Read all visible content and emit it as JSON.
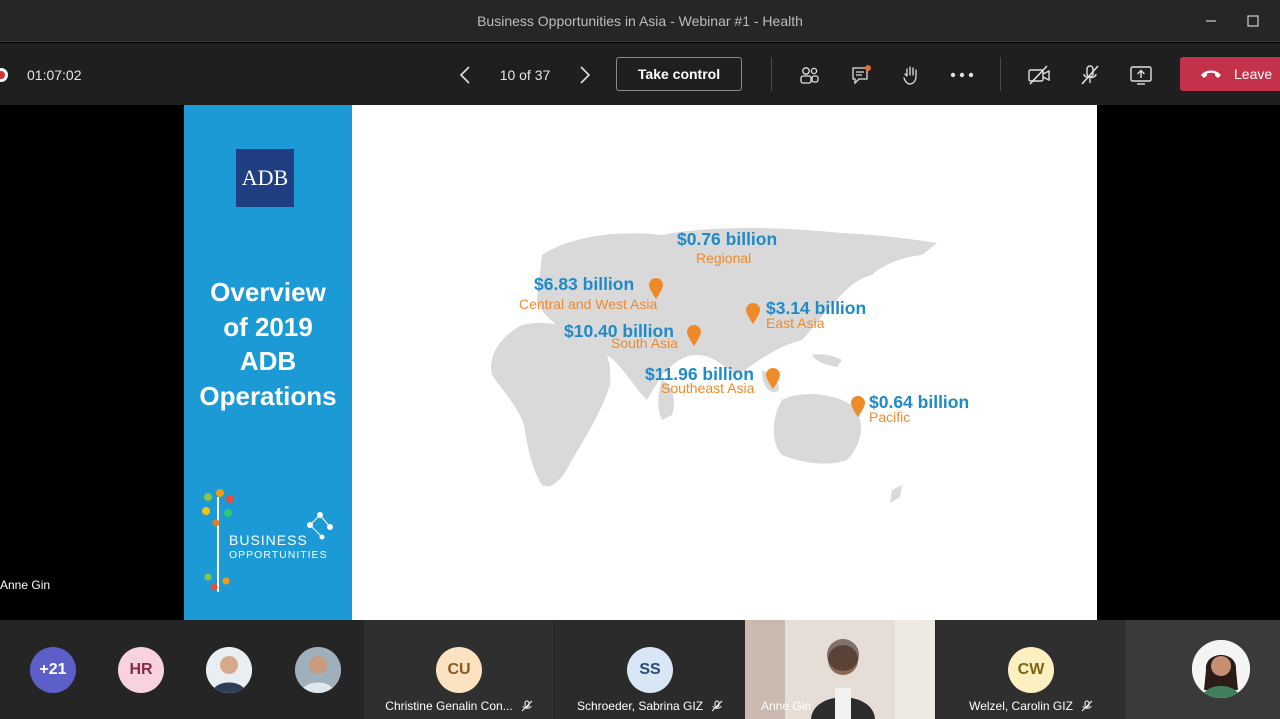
{
  "window": {
    "title": "Business Opportunities in Asia - Webinar #1 - Health"
  },
  "toolbar": {
    "timer": "01:07:02",
    "page_count": "10 of 37",
    "take_control_label": "Take control",
    "leave_label": "Leave",
    "icons": [
      "record-icon",
      "prev-slide-icon",
      "next-slide-icon",
      "participants-icon",
      "chat-icon",
      "raise-hand-icon",
      "more-icon",
      "camera-off-icon",
      "mic-off-icon",
      "share-icon",
      "hangup-icon"
    ],
    "leave_color": "#c4314b"
  },
  "slide": {
    "logo_text": "ADB",
    "title_lines": [
      "Overview",
      "of 2019",
      "ADB",
      "Operations"
    ],
    "brand_line1": "BUSINESS",
    "brand_line2": "OPPORTUNITIES",
    "accent_color": "#1b9ad6",
    "regions": [
      {
        "amount": "$0.76 billion",
        "region": "Regional"
      },
      {
        "amount": "$6.83 billion",
        "region": "Central and West Asia"
      },
      {
        "amount": "$3.14 billion",
        "region": "East Asia"
      },
      {
        "amount": "$10.40 billion",
        "region": "South Asia"
      },
      {
        "amount": "$11.96 billion",
        "region": "Southeast Asia"
      },
      {
        "amount": "$0.64 billion",
        "region": "Pacific"
      }
    ]
  },
  "presenter_label": "Anne Gin",
  "participants": {
    "overflow_count": "+21",
    "initials_hr": "HR",
    "tiles": [
      {
        "initials": "CU",
        "name": "Christine Genalin Con..."
      },
      {
        "initials": "SS",
        "name": "Schroeder, Sabrina GIZ"
      },
      {
        "initials": "",
        "name": "Anne Gin"
      },
      {
        "initials": "CW",
        "name": "Welzel, Carolin GIZ"
      }
    ]
  }
}
